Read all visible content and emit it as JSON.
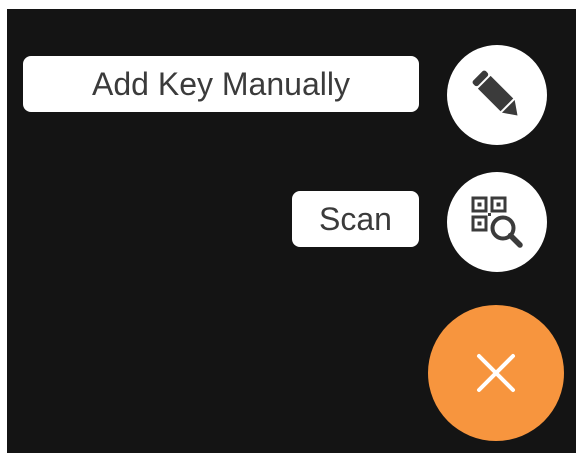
{
  "menu": {
    "add_manual_label": "Add Key Manually",
    "scan_label": "Scan"
  },
  "icons": {
    "add_manual": "pencil-icon",
    "scan": "qr-scan-icon",
    "close": "close-icon"
  },
  "colors": {
    "overlay_background": "#141414",
    "label_background": "#ffffff",
    "label_text": "#3b3b3b",
    "mini_fab_background": "#ffffff",
    "icon_color": "#3b3b3b",
    "main_fab_background": "#f7953e",
    "main_fab_icon": "#ffffff"
  }
}
